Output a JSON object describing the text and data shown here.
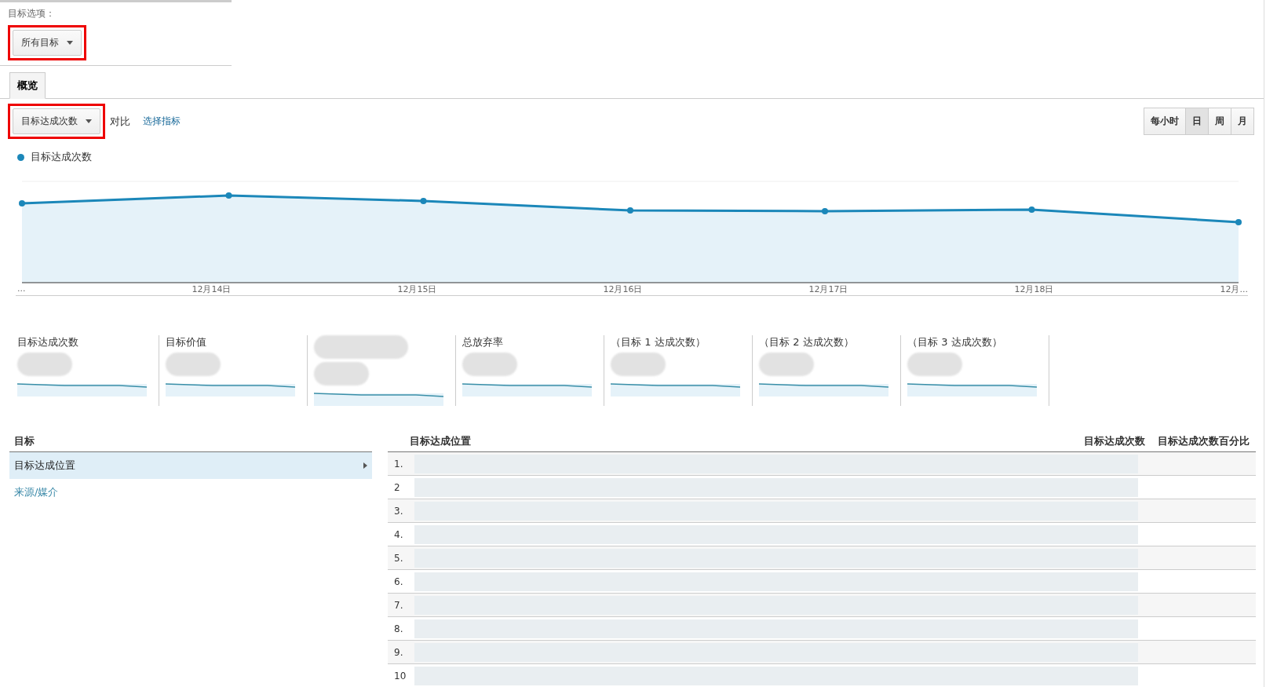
{
  "goal_options": {
    "label": "目标选项：",
    "dropdown": "所有目标"
  },
  "tabs": [
    {
      "label": "概览",
      "selected": true
    }
  ],
  "toolbar": {
    "metric_dropdown": "目标达成次数",
    "compare_label": "对比",
    "select_metric_link": "选择指标",
    "granularity": [
      {
        "label": "每小时",
        "selected": false
      },
      {
        "label": "日",
        "selected": true
      },
      {
        "label": "周",
        "selected": false
      },
      {
        "label": "月",
        "selected": false
      }
    ]
  },
  "chart": {
    "legend": "目标达成次数",
    "x_labels": [
      "...",
      "12月14日",
      "12月15日",
      "12月16日",
      "12月17日",
      "12月18日",
      "12月..."
    ]
  },
  "metric_cards": [
    {
      "kind": "labeled",
      "label": "目标达成次数"
    },
    {
      "kind": "labeled",
      "label": "目标价值"
    },
    {
      "kind": "obscured"
    },
    {
      "kind": "labeled",
      "label": "总放弃率"
    },
    {
      "kind": "labeled",
      "label": "（目标 1 达成次数）"
    },
    {
      "kind": "labeled",
      "label": "（目标 2 达成次数）"
    },
    {
      "kind": "labeled",
      "label": "（目标 3 达成次数）"
    }
  ],
  "dimension_panel": {
    "heading": "目标",
    "items": [
      {
        "label": "目标达成位置",
        "selected": true
      },
      {
        "label": "来源/媒介",
        "selected": false
      }
    ]
  },
  "table": {
    "columns": [
      "目标达成位置",
      "目标达成次数",
      "目标达成次数百分比"
    ],
    "rows": [
      {
        "index": "1."
      },
      {
        "index": "2"
      },
      {
        "index": "3."
      },
      {
        "index": "4."
      },
      {
        "index": "5."
      },
      {
        "index": "6."
      },
      {
        "index": "7."
      },
      {
        "index": "8."
      },
      {
        "index": "9."
      },
      {
        "index": "10"
      }
    ]
  }
}
